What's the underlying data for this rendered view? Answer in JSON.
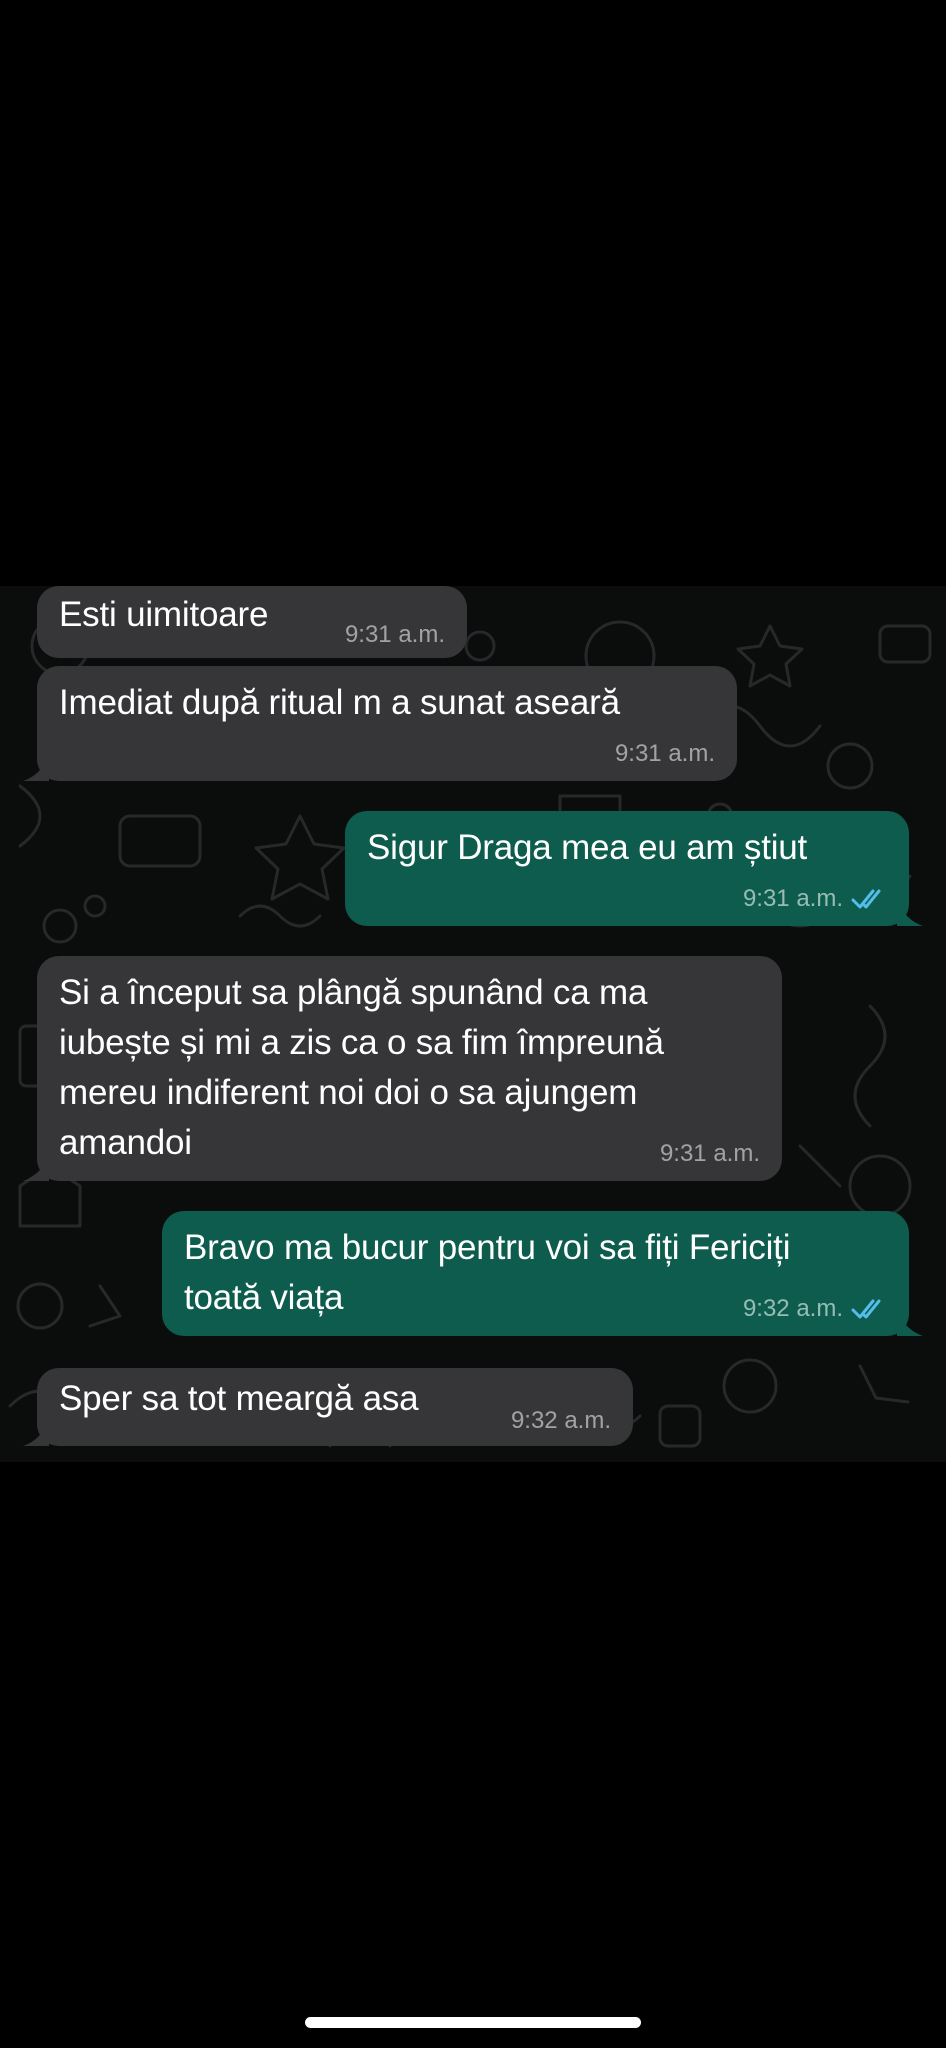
{
  "colors": {
    "incoming_bubble": "#363638",
    "outgoing_bubble": "#0d5c4d",
    "read_receipt": "#53bdeb",
    "chat_background": "#0b0c0c"
  },
  "messages": [
    {
      "direction": "incoming",
      "text": "Esti uimitoare",
      "time": "9:31 a.m."
    },
    {
      "direction": "incoming",
      "text": "Imediat după ritual m a sunat aseară",
      "time": "9:31 a.m."
    },
    {
      "direction": "outgoing",
      "text": "Sigur Draga mea eu am știut",
      "time": "9:31 a.m.",
      "status_icon": "double-check-icon"
    },
    {
      "direction": "incoming",
      "text": "Si a început sa plângă spunând ca ma\niubește și mi a zis ca o sa  fim împreună\nmereu indiferent noi doi o sa ajungem\namandoi",
      "time": "9:31 a.m."
    },
    {
      "direction": "outgoing",
      "text": "Bravo ma bucur pentru voi sa fiți Fericiți\ntoată viața",
      "time": "9:32 a.m.",
      "status_icon": "double-check-icon"
    },
    {
      "direction": "incoming",
      "text": "Sper sa tot meargă asa",
      "time": "9:32 a.m."
    }
  ]
}
